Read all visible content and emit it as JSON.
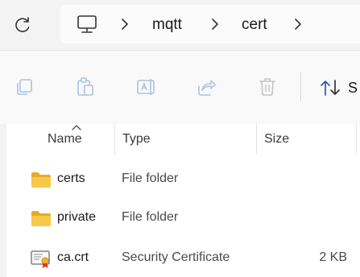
{
  "address_bar": {
    "breadcrumbs": [
      "mqtt",
      "cert"
    ]
  },
  "toolbar": {
    "buttons": [
      {
        "name": "copy",
        "icon": "copy-icon"
      },
      {
        "name": "paste",
        "icon": "paste-icon"
      },
      {
        "name": "rename",
        "icon": "rename-icon"
      },
      {
        "name": "share",
        "icon": "share-icon"
      },
      {
        "name": "delete",
        "icon": "delete-icon"
      }
    ],
    "sort_label": "S"
  },
  "columns": {
    "name": "Name",
    "type": "Type",
    "size": "Size"
  },
  "files": [
    {
      "name": "certs",
      "type": "File folder",
      "size": "",
      "icon": "folder-icon"
    },
    {
      "name": "private",
      "type": "File folder",
      "size": "",
      "icon": "folder-icon"
    },
    {
      "name": "ca.crt",
      "type": "Security Certificate",
      "size": "2 KB",
      "icon": "certificate-icon"
    }
  ],
  "colors": {
    "folder": "#f4c54a",
    "folder_dark": "#e8a92a",
    "accent": "#0067c0"
  }
}
